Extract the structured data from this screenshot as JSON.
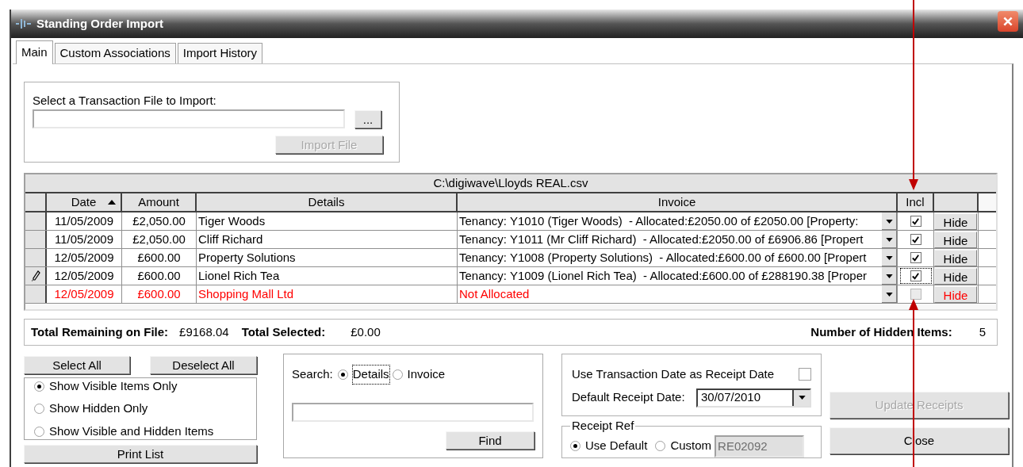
{
  "window": {
    "title": "Standing Order Import"
  },
  "tabs": [
    {
      "label": "Main",
      "selected": true
    },
    {
      "label": "Custom Associations",
      "selected": false
    },
    {
      "label": "Import History",
      "selected": false
    }
  ],
  "file_import": {
    "label": "Select a Transaction File to Import:",
    "browse_button": "...",
    "import_button": {
      "label": "Import File",
      "disabled": true
    }
  },
  "grid": {
    "caption": "C:\\digiwave\\Lloyds REAL.csv",
    "columns": [
      {
        "label": "Date",
        "sorted": true
      },
      {
        "label": "Amount",
        "sorted": false
      },
      {
        "label": "Details",
        "sorted": false
      },
      {
        "label": "Invoice",
        "sorted": false
      },
      {
        "label": "Incl",
        "sorted": false
      }
    ],
    "rows": [
      {
        "date": "11/05/2009",
        "amount": "£2,050.00",
        "details": "Tiger Woods",
        "invoice": "Tenancy: Y1010 (Tiger Woods)  - Allocated:£2050.00 of £2050.00 [Property:",
        "included": true,
        "allocated": true,
        "editing": false,
        "focused": false,
        "hide": "Hide"
      },
      {
        "date": "11/05/2009",
        "amount": "£2,050.00",
        "details": "Cliff Richard",
        "invoice": "Tenancy: Y1011 (Mr Cliff Richard)  - Allocated:£2050.00 of £6906.86 [Propert",
        "included": true,
        "allocated": true,
        "editing": false,
        "focused": false,
        "hide": "Hide"
      },
      {
        "date": "12/05/2009",
        "amount": "£600.00",
        "details": "Property Solutions",
        "invoice": "Tenancy: Y1008 (Property Solutions)  - Allocated:£600.00 of £600.00 [Propert",
        "included": true,
        "allocated": true,
        "editing": false,
        "focused": false,
        "hide": "Hide"
      },
      {
        "date": "12/05/2009",
        "amount": "£600.00",
        "details": "Lionel Rich Tea",
        "invoice": "Tenancy: Y1009 (Lionel Rich Tea)  - Allocated:£600.00 of £288190.38 [Proper",
        "included": true,
        "allocated": true,
        "editing": true,
        "focused": true,
        "hide": "Hide"
      },
      {
        "date": "12/05/2009",
        "amount": "£600.00",
        "details": "Shopping Mall Ltd",
        "invoice": "Not Allocated",
        "included": false,
        "allocated": false,
        "editing": false,
        "focused": false,
        "hide": "Hide"
      }
    ]
  },
  "totals": {
    "remaining_label": "Total Remaining on File:",
    "remaining": "£9168.04",
    "selected_label": "Total Selected:",
    "selected": "£0.00",
    "hidden_label": "Number of Hidden Items:",
    "hidden": "5"
  },
  "select_all_button": "Select All",
  "deselect_all_button": "Deselect All",
  "visibility_options": [
    {
      "label": "Show Visible Items Only",
      "selected": true
    },
    {
      "label": "Show Hidden Only",
      "selected": false
    },
    {
      "label": "Show Visible and Hidden Items",
      "selected": false
    }
  ],
  "print_button": "Print List",
  "search": {
    "label": "Search:",
    "options": [
      {
        "label": "Details",
        "selected": true
      },
      {
        "label": "Invoice",
        "selected": false
      }
    ],
    "find_button": "Find"
  },
  "receipt_date": {
    "use_transaction_label": "Use Transaction Date as Receipt Date",
    "use_transaction_checked": false,
    "default_label": "Default Receipt Date:",
    "default_value": "30/07/2010"
  },
  "receipt_ref": {
    "legend": "Receipt Ref",
    "options": [
      {
        "label": "Use Default",
        "selected": true
      },
      {
        "label": "Custom",
        "selected": false
      }
    ],
    "custom_value": "RE02092",
    "custom_disabled": true
  },
  "update_button": {
    "label": "Update Receipts",
    "disabled": true
  },
  "close_button": "Close"
}
